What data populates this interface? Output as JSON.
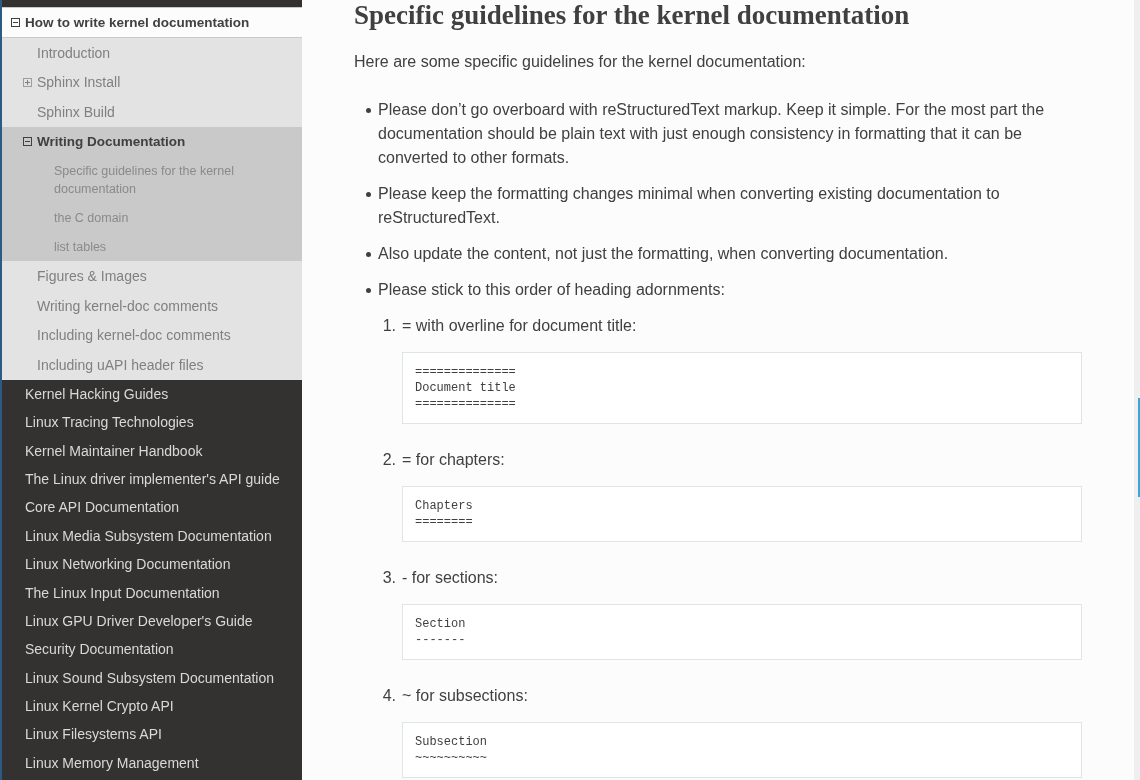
{
  "sidebar": {
    "items": [
      {
        "label": "How to write kernel documentation",
        "selected": true,
        "expanded": true,
        "children": [
          {
            "label": "Introduction",
            "selected": false
          },
          {
            "label": "Sphinx Install",
            "selected": false,
            "expanded": false
          },
          {
            "label": "Sphinx Build",
            "selected": false
          },
          {
            "label": "Writing Documentation",
            "selected": true,
            "expanded": true,
            "children": [
              {
                "label": "Specific guidelines for the kernel documentation",
                "selected": false
              },
              {
                "label": "the C domain",
                "selected": false
              },
              {
                "label": "list tables",
                "selected": false
              }
            ]
          },
          {
            "label": "Figures & Images",
            "selected": false
          },
          {
            "label": "Writing kernel-doc comments",
            "selected": false
          },
          {
            "label": "Including kernel-doc comments",
            "selected": false
          },
          {
            "label": "Including uAPI header files",
            "selected": false
          }
        ]
      },
      {
        "label": "Kernel Hacking Guides",
        "selected": false
      },
      {
        "label": "Linux Tracing Technologies",
        "selected": false
      },
      {
        "label": "Kernel Maintainer Handbook",
        "selected": false
      },
      {
        "label": "The Linux driver implementer's API guide",
        "selected": false
      },
      {
        "label": "Core API Documentation",
        "selected": false
      },
      {
        "label": "Linux Media Subsystem Documentation",
        "selected": false
      },
      {
        "label": "Linux Networking Documentation",
        "selected": false
      },
      {
        "label": "The Linux Input Documentation",
        "selected": false
      },
      {
        "label": "Linux GPU Driver Developer's Guide",
        "selected": false
      },
      {
        "label": "Security Documentation",
        "selected": false
      },
      {
        "label": "Linux Sound Subsystem Documentation",
        "selected": false
      },
      {
        "label": "Linux Kernel Crypto API",
        "selected": false
      },
      {
        "label": "Linux Filesystems API",
        "selected": false
      },
      {
        "label": "Linux Memory Management",
        "selected": false
      }
    ]
  },
  "content": {
    "heading": "Specific guidelines for the kernel documentation",
    "intro": "Here are some specific guidelines for the kernel documentation:",
    "bullets": [
      {
        "text": "Please don’t go overboard with reStructuredText markup. Keep it simple. For the most part the documentation should be plain text with just enough consistency in formatting that it can be converted to other formats."
      },
      {
        "text": "Please keep the formatting changes minimal when converting existing documentation to reStructuredText."
      },
      {
        "text": "Also update the content, not just the formatting, when converting documentation."
      },
      {
        "text": "Please stick to this order of heading adornments:",
        "steps": [
          {
            "number": "1.",
            "text": "= with overline for document title:",
            "code": "==============\nDocument title\n=============="
          },
          {
            "number": "2.",
            "text": "= for chapters:",
            "code": "Chapters\n========"
          },
          {
            "number": "3.",
            "text": "- for sections:",
            "code": "Section\n-------"
          },
          {
            "number": "4.",
            "text": "~ for subsections:",
            "code": "Subsection\n~~~~~~~~~~"
          }
        ]
      }
    ]
  }
}
